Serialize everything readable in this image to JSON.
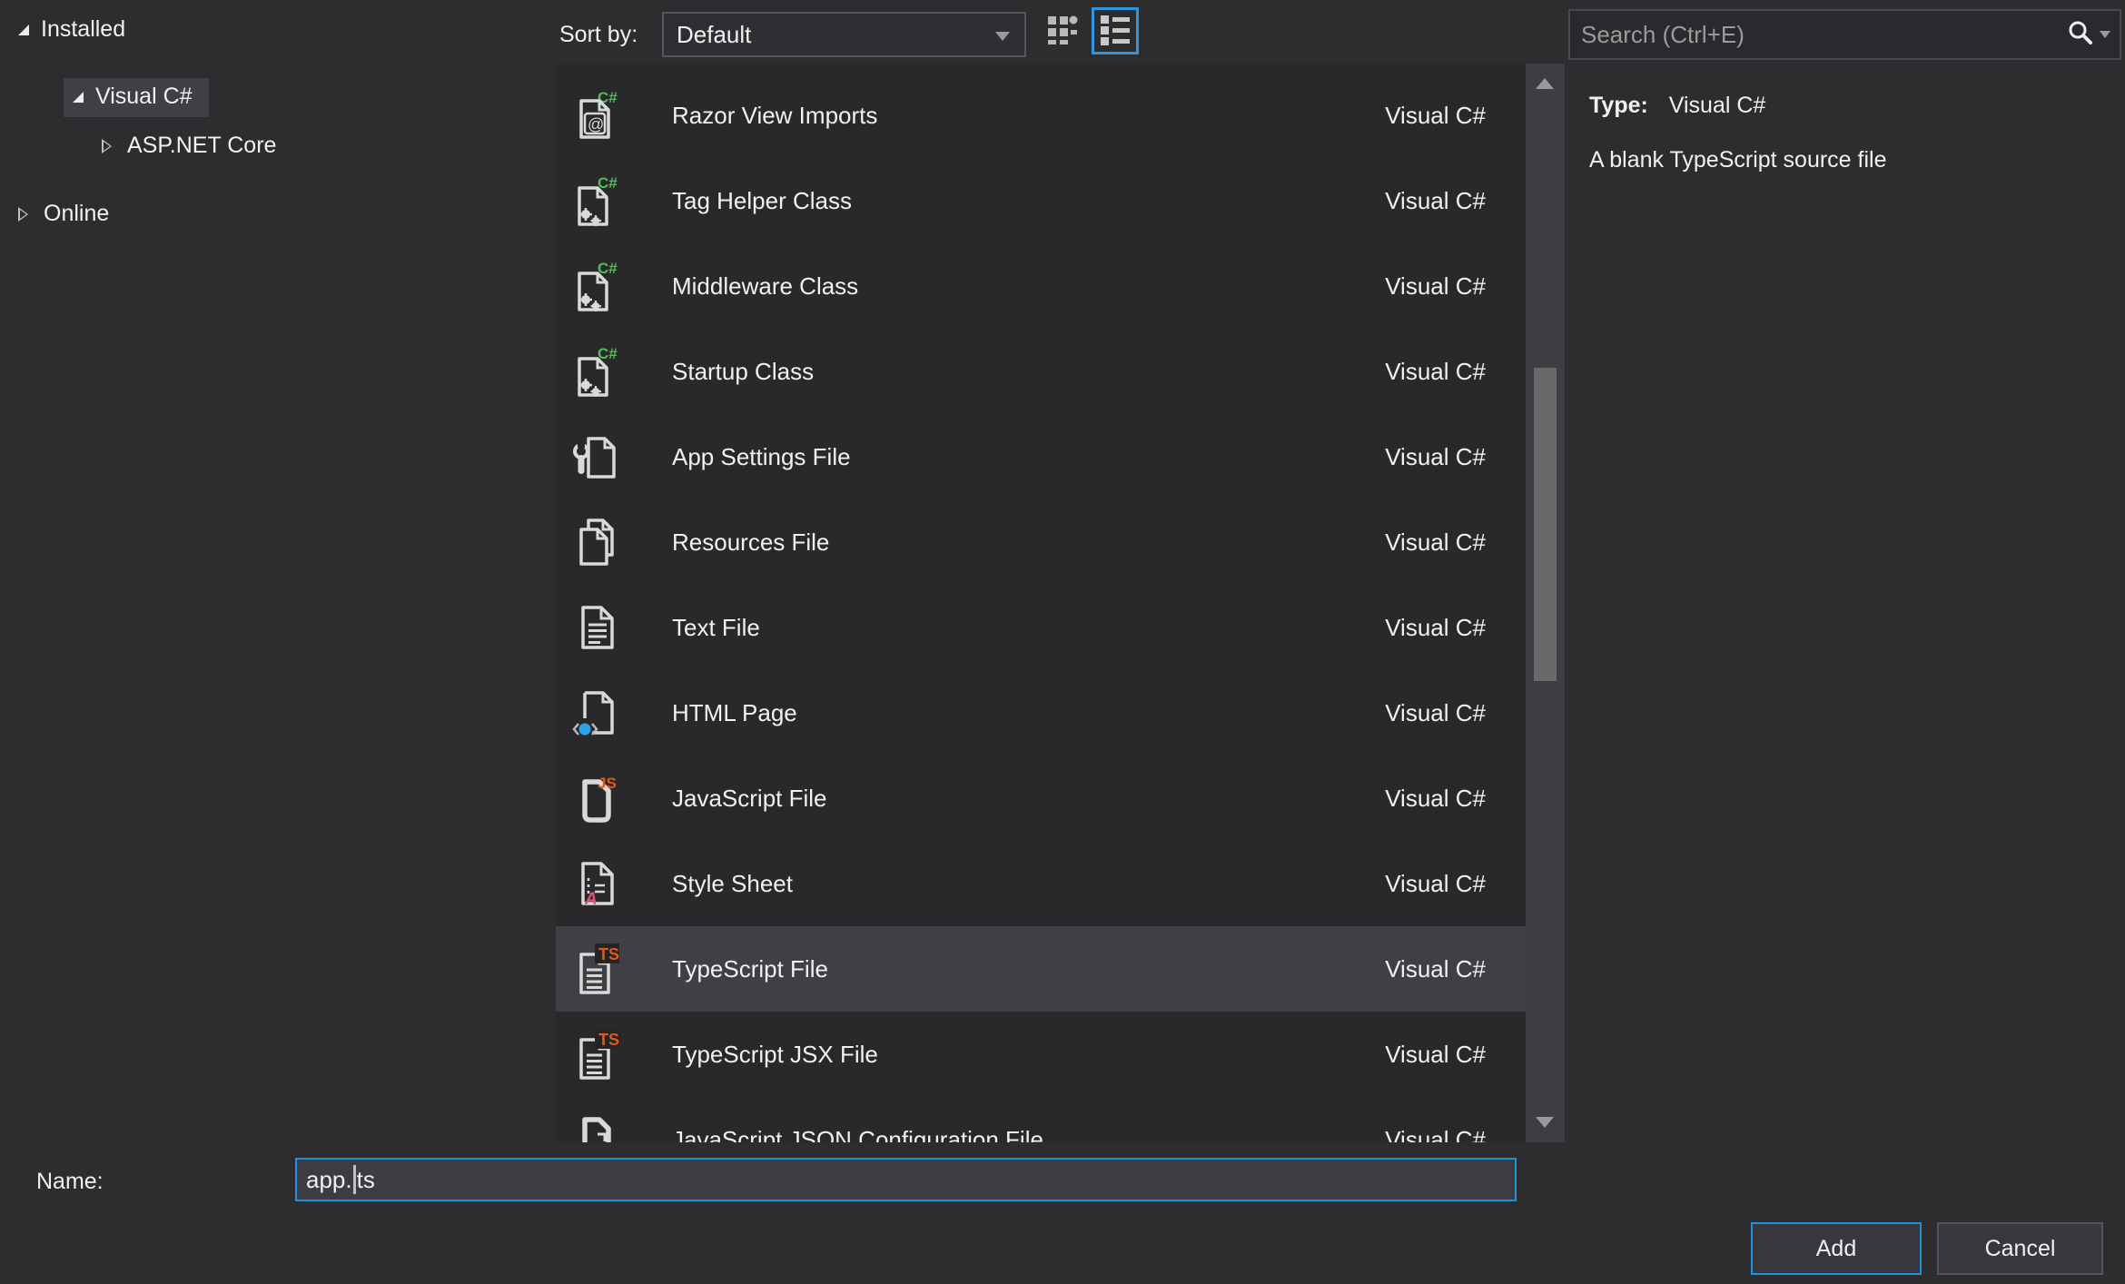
{
  "tree": {
    "items": [
      {
        "label": "Installed",
        "state": "expanded",
        "selected": false
      },
      {
        "label": "Visual C#",
        "state": "expanded",
        "selected": true
      },
      {
        "label": "ASP.NET Core",
        "state": "collapsed",
        "selected": false
      },
      {
        "label": "Online",
        "state": "collapsed",
        "selected": false
      }
    ]
  },
  "toolbar": {
    "sort_label": "Sort by:",
    "sort_value": "Default",
    "view_buttons": [
      {
        "name": "small-icons-view",
        "selected": false
      },
      {
        "name": "list-view",
        "selected": true
      }
    ]
  },
  "list": {
    "items": [
      {
        "name": "Razor View Imports",
        "category": "Visual C#",
        "icon": "razor-view-imports-icon",
        "selected": false
      },
      {
        "name": "Tag Helper Class",
        "category": "Visual C#",
        "icon": "csharp-class-icon",
        "selected": false
      },
      {
        "name": "Middleware Class",
        "category": "Visual C#",
        "icon": "csharp-class-icon",
        "selected": false
      },
      {
        "name": "Startup Class",
        "category": "Visual C#",
        "icon": "csharp-class-icon",
        "selected": false
      },
      {
        "name": "App Settings File",
        "category": "Visual C#",
        "icon": "app-settings-icon",
        "selected": false
      },
      {
        "name": "Resources File",
        "category": "Visual C#",
        "icon": "resources-file-icon",
        "selected": false
      },
      {
        "name": "Text File",
        "category": "Visual C#",
        "icon": "text-file-icon",
        "selected": false
      },
      {
        "name": "HTML Page",
        "category": "Visual C#",
        "icon": "html-page-icon",
        "selected": false
      },
      {
        "name": "JavaScript File",
        "category": "Visual C#",
        "icon": "javascript-file-icon",
        "selected": false
      },
      {
        "name": "Style Sheet",
        "category": "Visual C#",
        "icon": "style-sheet-icon",
        "selected": false
      },
      {
        "name": "TypeScript File",
        "category": "Visual C#",
        "icon": "typescript-file-icon",
        "selected": true
      },
      {
        "name": "TypeScript JSX File",
        "category": "Visual C#",
        "icon": "typescript-jsx-file-icon",
        "selected": false
      },
      {
        "name": "JavaScript JSON Configuration File",
        "category": "Visual C#",
        "icon": "json-config-icon",
        "selected": false
      }
    ]
  },
  "search": {
    "placeholder": "Search (Ctrl+E)"
  },
  "details": {
    "type_label": "Type:",
    "type_value": "Visual C#",
    "description": "A blank TypeScript source file"
  },
  "footer": {
    "name_label": "Name:",
    "name_value": "app.ts",
    "name_caret_pre": "app.",
    "name_caret_post": "ts",
    "add_label": "Add",
    "cancel_label": "Cancel"
  },
  "colors": {
    "accent_blue": "#2f93e0",
    "csharp_green": "#4cc152",
    "script_orange": "#e4590e",
    "style_pink": "#e05575",
    "html_blue": "#2ba3e8"
  }
}
